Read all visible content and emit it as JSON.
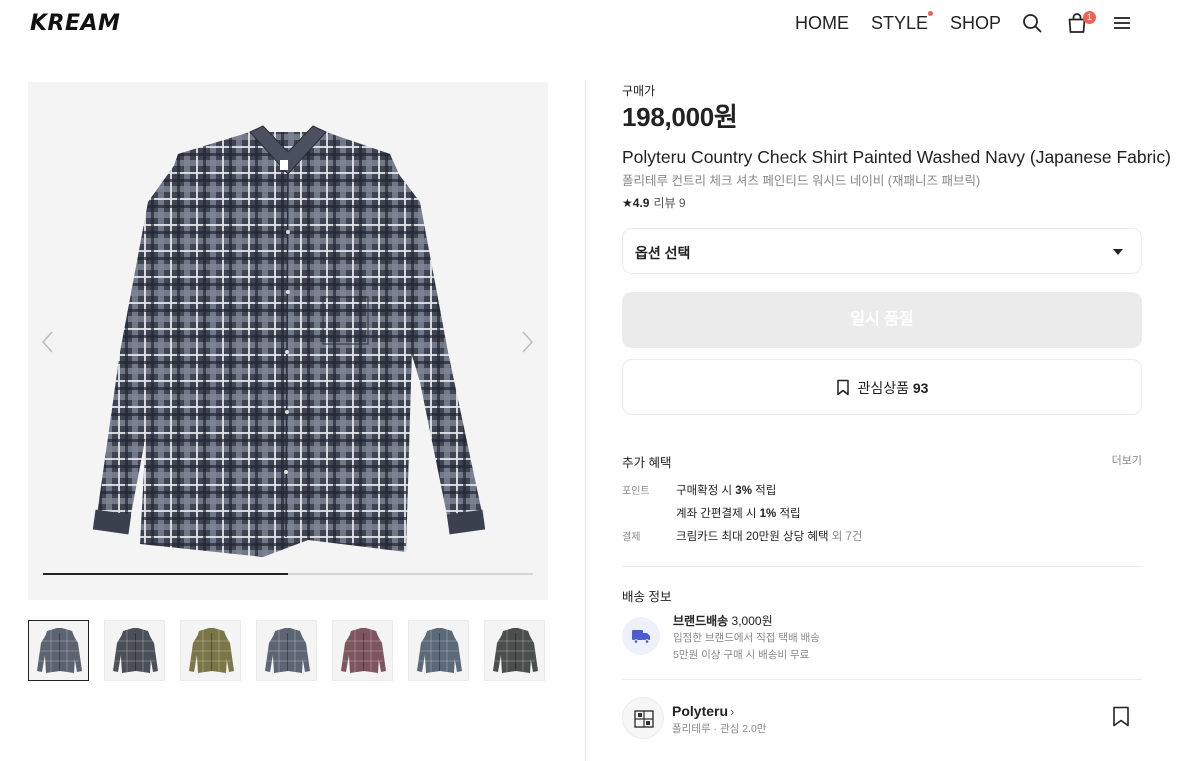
{
  "header": {
    "logo": "KREAM",
    "nav": [
      "HOME",
      "STYLE",
      "SHOP"
    ],
    "cart_count": "1"
  },
  "gallery": {
    "progress": 0.5,
    "thumb_colors": [
      "#5b6272",
      "#4b4f57",
      "#7b7648",
      "#5d6575",
      "#7d5560",
      "#5a6a78",
      "#4a4e4c"
    ]
  },
  "product": {
    "buy_label": "구매가",
    "price": "198,000원",
    "title_en": "Polyteru Country Check Shirt Painted Washed Navy (Japanese Fabric)",
    "title_ko": "폴리테루 컨트리 체크 셔츠 페인티드 워시드 네이비 (재패니즈 패브릭)",
    "rating": "4.9",
    "review_label": "리뷰 9"
  },
  "option": {
    "label": "옵션 선택"
  },
  "buttons": {
    "soldout": "일시 품절",
    "wish_label": "관심상품",
    "wish_count": "93"
  },
  "benefits": {
    "title": "추가 혜택",
    "more": "더보기",
    "rows": [
      {
        "key": "포인트",
        "pre": "구매확정 시 ",
        "bold": "3%",
        "post": " 적립",
        "extra": ""
      },
      {
        "key": "",
        "pre": "계좌 간편결제 시 ",
        "bold": "1%",
        "post": " 적립",
        "extra": ""
      },
      {
        "key": "결제",
        "pre": "크림카드 최대 20만원 상당 혜택",
        "bold": "",
        "post": "",
        "extra": " 외 7건"
      }
    ]
  },
  "shipping": {
    "title": "배송 정보",
    "name": "브랜드배송",
    "fee": "3,000원",
    "line2": "입점한 브랜드에서 직접 택배 배송",
    "line3": "5만원 이상 구매 시 배송비 무료"
  },
  "brand": {
    "name": "Polyteru",
    "sub": "폴리테루 · 관심 2.0만"
  },
  "colors": {
    "accent": "#ef6253",
    "soldout_bg": "#ebebeb",
    "truck_icon": "#4a5cd0"
  }
}
